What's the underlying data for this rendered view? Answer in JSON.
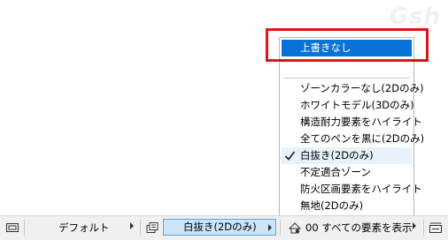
{
  "watermark": "Gsh",
  "menu": {
    "top_item": "上書きなし",
    "items": [
      {
        "label": "ゾーンカラーなし(2Dのみ)",
        "checked": false
      },
      {
        "label": "ホワイトモデル(3Dのみ)",
        "checked": false
      },
      {
        "label": "構造耐力要素をハイライト",
        "checked": false
      },
      {
        "label": "全てのペンを黒に(2Dのみ)",
        "checked": false
      },
      {
        "label": "白抜き(2Dのみ)",
        "checked": true
      },
      {
        "label": "不定適合ゾーン",
        "checked": false
      },
      {
        "label": "防火区画要素をハイライト",
        "checked": false
      },
      {
        "label": "無地(2Dのみ)",
        "checked": false
      }
    ]
  },
  "status_bar": {
    "field1": "デフォルト",
    "field2": "白抜き(2Dのみ)",
    "field3": "00 すべての要素を表示"
  },
  "colors": {
    "menu_highlight": "#0a72d6",
    "annotation_red": "#e0121b",
    "selected_field_bg": "#cde4f7"
  }
}
